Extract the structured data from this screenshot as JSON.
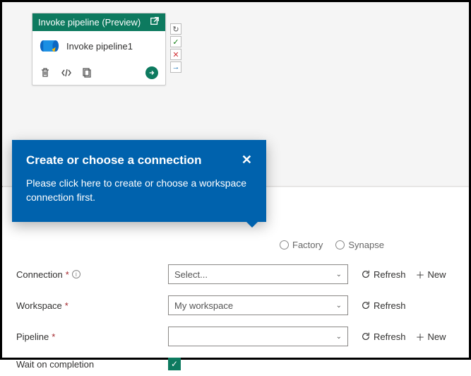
{
  "activity": {
    "header": "Invoke pipeline (Preview)",
    "name": "Invoke pipeline1"
  },
  "callout": {
    "title": "Create or choose a connection",
    "body": "Please click here to create or choose a workspace connection first."
  },
  "factory_type": {
    "opt_factory": "Factory",
    "opt_synapse": "Synapse"
  },
  "form": {
    "connection_label": "Connection",
    "connection_value": "Select...",
    "workspace_label": "Workspace",
    "workspace_value": "My workspace",
    "pipeline_label": "Pipeline",
    "pipeline_value": "",
    "wait_label": "Wait on completion"
  },
  "actions": {
    "refresh": "Refresh",
    "new": "New"
  }
}
